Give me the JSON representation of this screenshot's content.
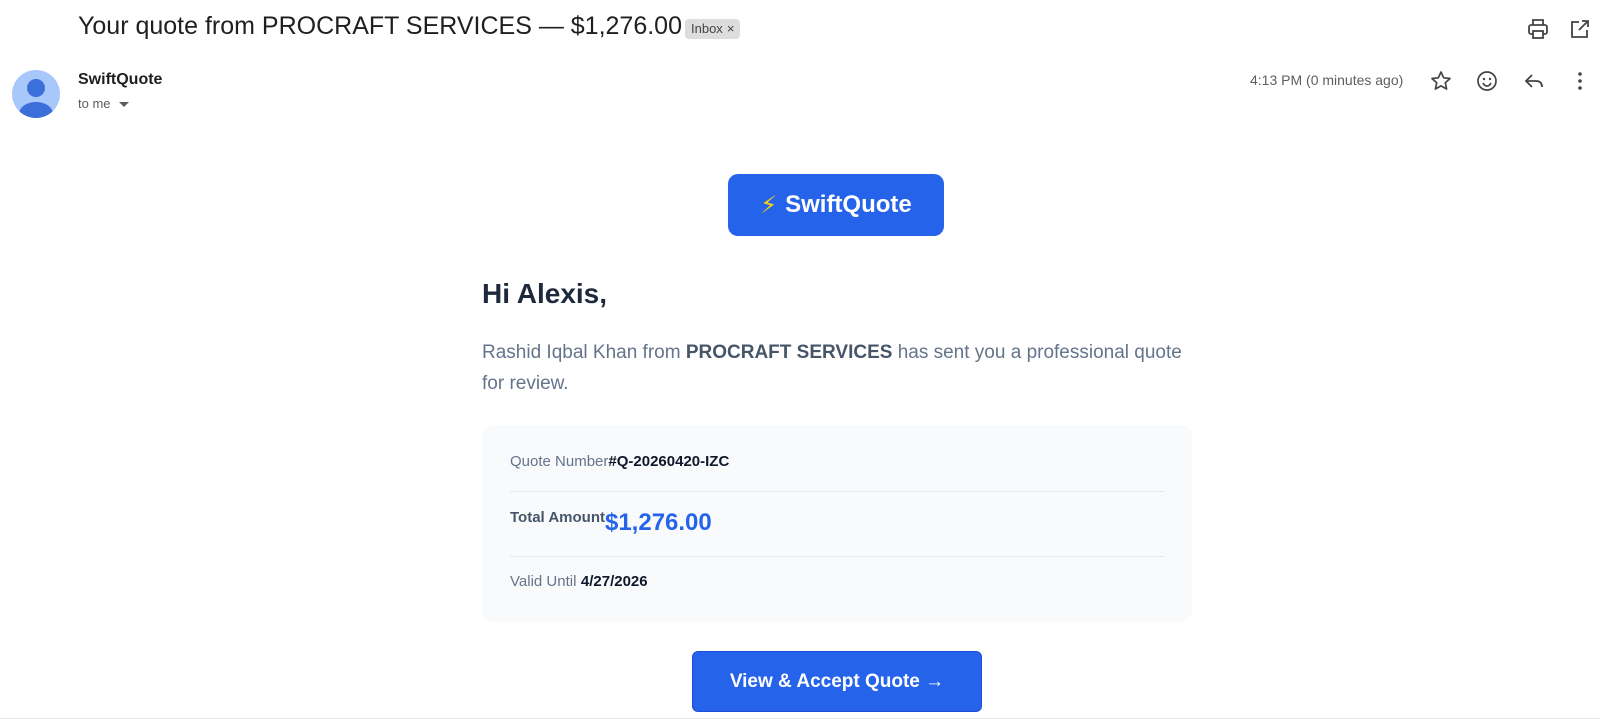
{
  "email": {
    "subject": "Your quote from PROCRAFT SERVICES — $1,276.00",
    "label_chip": "Inbox",
    "label_chip_close": "×",
    "sender": "SwiftQuote",
    "recipient": "to me",
    "timestamp": "4:13 PM (0 minutes ago)"
  },
  "icons": {
    "print": "print-icon",
    "popout": "open-in-new-window-icon",
    "star": "star-icon",
    "emoji": "emoji-reaction-icon",
    "reply": "reply-icon",
    "more": "more-vertical-icon",
    "avatar": "person-avatar-icon",
    "bolt": "lightning-bolt-icon"
  },
  "body": {
    "brand_bolt": "⚡",
    "brand_name": "SwiftQuote",
    "greeting": "Hi Alexis,",
    "intro_prefix": "Rashid Iqbal Khan from ",
    "intro_company": "PROCRAFT SERVICES",
    "intro_suffix": " has sent you a professional quote for review.",
    "quote": {
      "number_label": "Quote Number",
      "number_value": "#Q-20260420-IZC",
      "total_label": "Total Amount",
      "total_value": "$1,276.00",
      "valid_label": "Valid Until",
      "valid_value": "4/27/2026"
    },
    "cta_label": "View & Accept Quote →"
  },
  "colors": {
    "brand_blue": "#2563eb",
    "card_bg": "#f8fafc",
    "avatar_bg": "#a8c7fa",
    "bolt": "#facc15"
  }
}
